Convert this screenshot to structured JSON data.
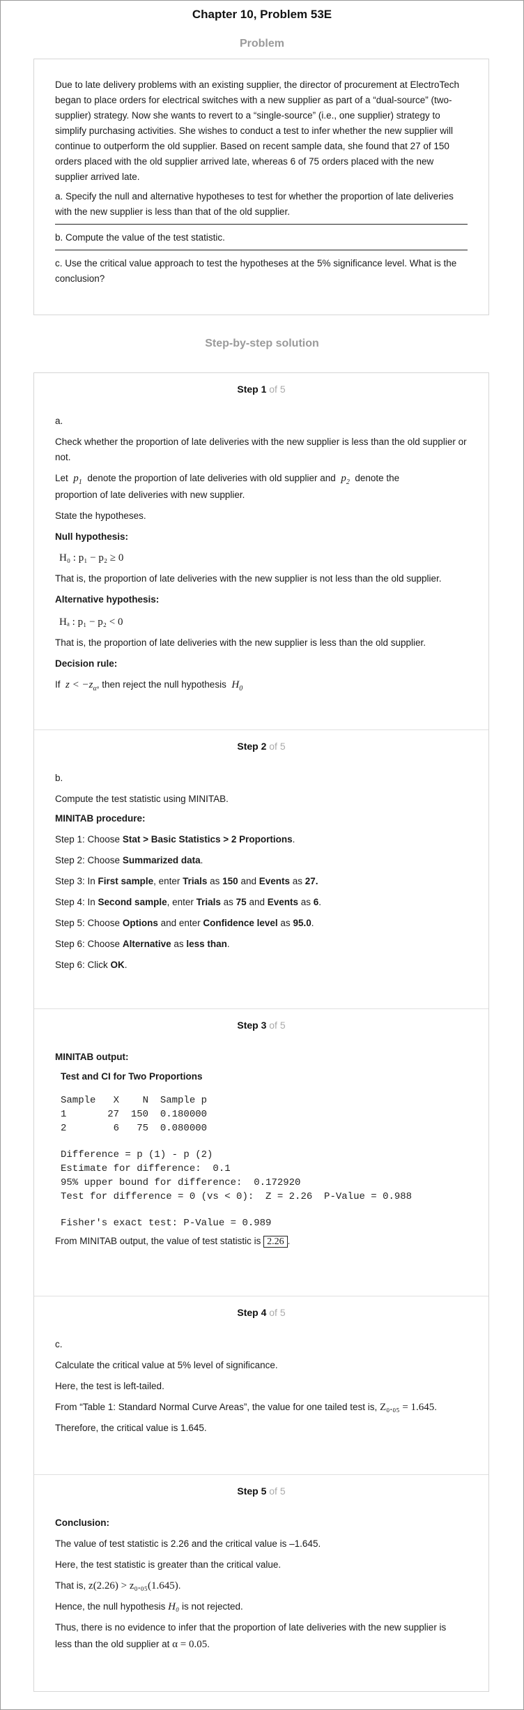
{
  "chapter_title": "Chapter 10, Problem 53E",
  "problem_heading": "Problem",
  "problem": {
    "intro": "Due to late delivery problems with an existing supplier, the director of procurement at ElectroTech began to place orders for electrical switches with a new supplier as part of a “dual-source” (two-supplier) strategy. Now she wants to revert to a “single-source” (i.e., one supplier) strategy to simplify purchasing activities. She wishes to conduct a test to infer whether the new supplier will continue to outperform the old supplier. Based on recent sample data, she found that 27 of 150 orders placed with the old supplier arrived late, whereas 6 of 75 orders placed with the new supplier arrived late.",
    "part_a": "a. Specify the null and alternative hypotheses to test for whether the proportion of late deliveries with the new supplier is less than that of the old supplier.",
    "part_b": "b. Compute the value of the test statistic.",
    "part_c": "c. Use the critical value approach to test the hypotheses at the 5% significance level. What is the conclusion?"
  },
  "solution_heading": "Step-by-step solution",
  "steps": [
    {
      "label": "Step 1",
      "of": "of 5",
      "part": "a.",
      "l1": "Check whether the proportion of late deliveries with the new supplier is less than the old supplier or not.",
      "l2a": "Let",
      "p1": "p",
      "p1sub": "1",
      "l2b": "denote the proportion of late deliveries with old supplier and",
      "p2": "p",
      "p2sub": "2",
      "l2c": "denote the",
      "l2d": "proportion of late deliveries with new supplier.",
      "l3": "State the hypotheses.",
      "null_head": "Null hypothesis:",
      "null_eq": "H₀ : p₁ − p₂ ≥ 0",
      "null_text": "That is, the proportion of late deliveries with the new supplier is not less than the old supplier.",
      "alt_head": "Alternative hypothesis:",
      "alt_eq": "Hₐ : p₁ − p₂ < 0",
      "alt_text": "That is, the proportion of late deliveries with the new supplier is less than the old supplier.",
      "rule_head": "Decision rule:",
      "rule_a": "If",
      "rule_eq": "z < −z",
      "rule_eq_sub": "α",
      "rule_b": ", then reject the null hypothesis",
      "rule_h": "H",
      "rule_h_sub": "0"
    },
    {
      "label": "Step 2",
      "of": "of 5",
      "part": "b.",
      "l1": "Compute the test statistic using MINITAB.",
      "proc_head": "MINITAB procedure:",
      "s1a": "Step 1: Choose ",
      "s1b": "Stat > Basic Statistics > 2 Proportions",
      "s1c": ".",
      "s2a": "Step 2: Choose ",
      "s2b": "Summarized data",
      "s2c": ".",
      "s3a": "Step 3: In ",
      "s3b": "First sample",
      "s3c": ", enter ",
      "s3d": "Trials",
      "s3e": " as ",
      "s3f": "150",
      "s3g": " and ",
      "s3h": "Events",
      "s3i": " as ",
      "s3j": "27.",
      "s4a": "Step 4: In ",
      "s4b": "Second sample",
      "s4c": ", enter ",
      "s4d": "Trials",
      "s4e": " as ",
      "s4f": "75",
      "s4g": " and ",
      "s4h": "Events",
      "s4i": " as ",
      "s4j": "6",
      "s4k": ".",
      "s5a": "Step 5: Choose ",
      "s5b": "Options",
      "s5c": " and enter ",
      "s5d": "Confidence level",
      "s5e": " as ",
      "s5f": "95.0",
      "s5g": ".",
      "s6a": "Step 6: Choose ",
      "s6b": "Alternative",
      "s6c": " as ",
      "s6d": "less than",
      "s6e": ".",
      "s7a": "Step 6: Click ",
      "s7b": "OK",
      "s7c": "."
    },
    {
      "label": "Step 3",
      "of": "of 5",
      "out_head": "MINITAB output:",
      "test_title": "Test and CI for Two Proportions",
      "mono1": "Sample   X    N  Sample p",
      "mono2": "1       27  150  0.180000",
      "mono3": "2        6   75  0.080000",
      "mono4": "Difference = p (1) - p (2)",
      "mono5": "Estimate for difference:  0.1",
      "mono6": "95% upper bound for difference:  0.172920",
      "mono7": "Test for difference = 0 (vs < 0):  Z = 2.26  P-Value = 0.988",
      "mono8": "Fisher's exact test: P-Value = 0.989",
      "concl_a": "From MINITAB output, the value of test statistic is",
      "concl_val": "2.26",
      "concl_b": "."
    },
    {
      "label": "Step 4",
      "of": "of 5",
      "part": "c.",
      "l1": "Calculate the critical value at 5% level of significance.",
      "l2": "Here, the test is left-tailed.",
      "l3a": "From “Table 1: Standard Normal Curve Areas”, the value for one tailed test is,",
      "l3eq": "Z₀.₀₅ = 1.645",
      "l3b": ".",
      "l4": "Therefore, the critical value is 1.645."
    },
    {
      "label": "Step 5",
      "of": "of 5",
      "concl_head": "Conclusion:",
      "l1": "The value of test statistic is 2.26 and the critical value is –1.645.",
      "l2": "Here, the test statistic is greater than the critical value.",
      "l3a": "That is,",
      "l3eq": "z(2.26) > z₀.₀₅(1.645)",
      "l3b": ".",
      "l4a": "Hence, the null hypothesis",
      "l4eq": "H₀",
      "l4b": "is not rejected.",
      "l5": "Thus, there is no evidence to infer that the proportion of late deliveries with the new supplier is",
      "l6a": "less than the old supplier at",
      "l6eq": "α = 0.05",
      "l6b": "."
    }
  ]
}
